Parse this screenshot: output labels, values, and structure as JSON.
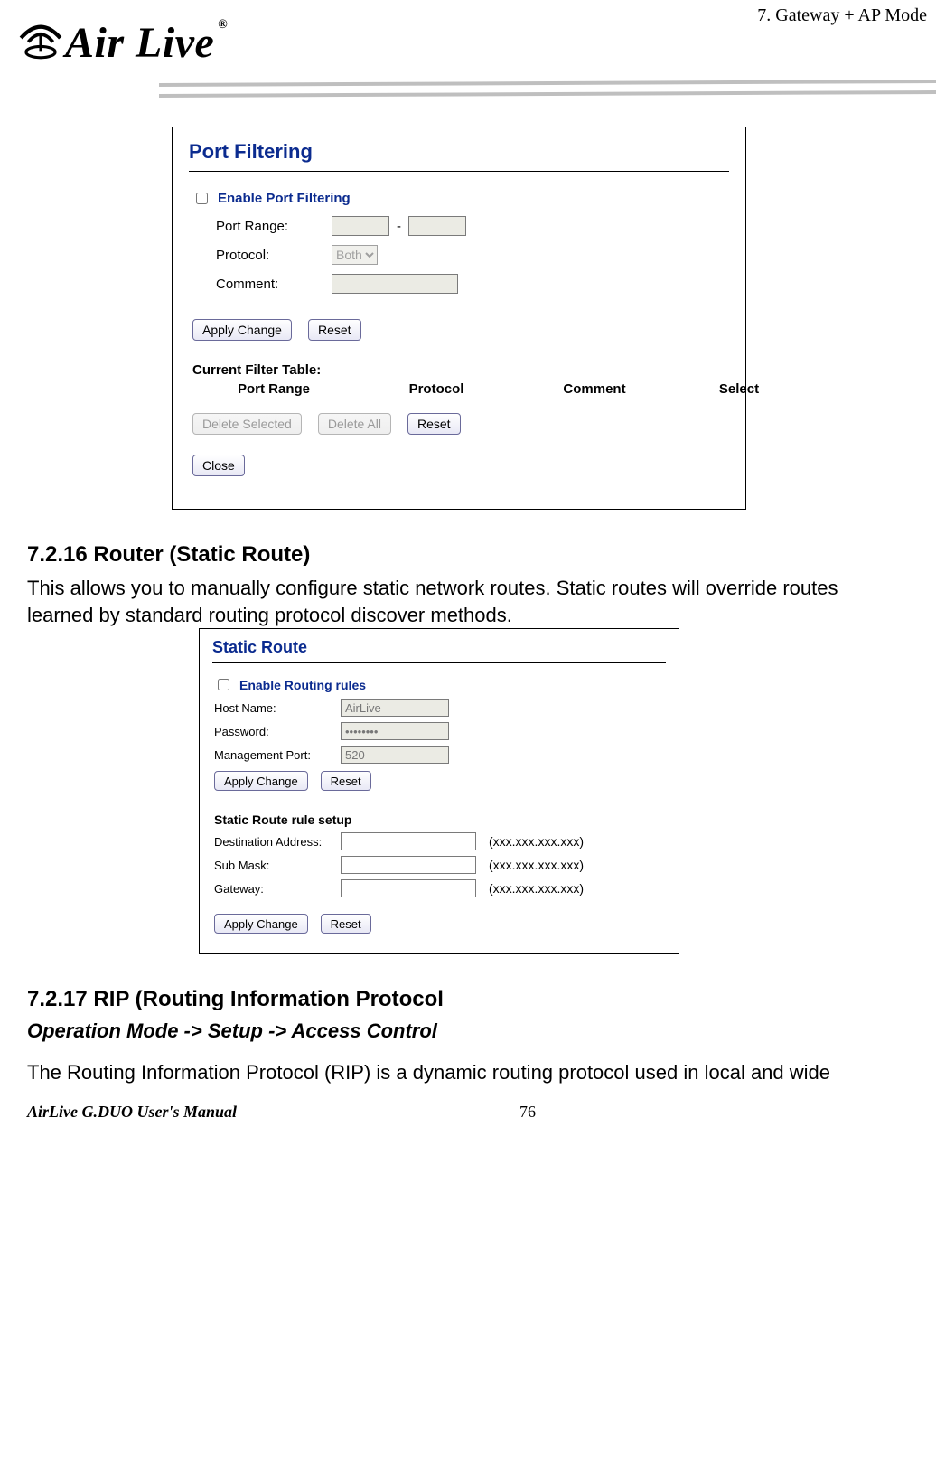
{
  "header": {
    "chapter": "7.  Gateway  +  AP    Mode",
    "logo_text": "Air Live",
    "registered": "®"
  },
  "panel_port_filtering": {
    "title": "Port Filtering",
    "enable_label": "Enable Port Filtering",
    "rows": {
      "port_range_label": "Port Range:",
      "port_range_sep": "-",
      "protocol_label": "Protocol:",
      "protocol_value": "Both",
      "comment_label": "Comment:"
    },
    "buttons": {
      "apply": "Apply Change",
      "reset": "Reset",
      "delete_selected": "Delete Selected",
      "delete_all": "Delete All",
      "reset2": "Reset",
      "close": "Close"
    },
    "table": {
      "title": "Current Filter Table:",
      "cols": {
        "c1": "Port Range",
        "c2": "Protocol",
        "c3": "Comment",
        "c4": "Select"
      }
    }
  },
  "section_7_2_16": {
    "heading": "7.2.16 Router (Static Route)",
    "body": "This allows you to manually configure static network routes. Static routes will override routes learned by standard routing protocol discover methods."
  },
  "panel_static_route": {
    "title": "Static Route",
    "enable_label": "Enable Routing rules",
    "rows1": {
      "host_label": "Host Name:",
      "host_value": "AirLive",
      "pass_label": "Password:",
      "pass_value": "••••••••",
      "port_label": "Management Port:",
      "port_value": "520"
    },
    "buttons1": {
      "apply": "Apply Change",
      "reset": "Reset"
    },
    "subtitle": "Static Route rule setup",
    "rows2": {
      "dest_label": "Destination Address:",
      "mask_label": "Sub Mask:",
      "gw_label": "Gateway:",
      "hint": "(xxx.xxx.xxx.xxx)"
    },
    "buttons2": {
      "apply": "Apply Change",
      "reset": "Reset"
    }
  },
  "section_7_2_17": {
    "heading": "7.2.17 RIP (Routing Information Protocol",
    "path": "Operation Mode -> Setup -> Access Control",
    "body": "The Routing Information Protocol (RIP) is a dynamic routing protocol used in local and wide"
  },
  "footer": {
    "left": "AirLive G.DUO User's Manual",
    "page": "76"
  }
}
